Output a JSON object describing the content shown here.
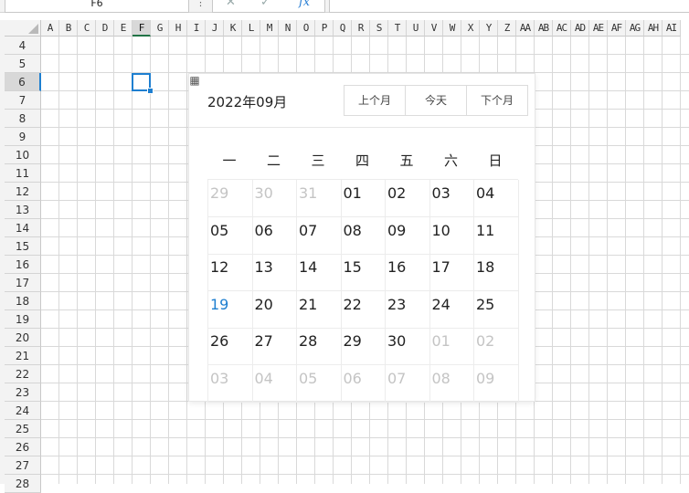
{
  "formula_bar": {
    "name_box": "F6",
    "more_icon": "⋮",
    "cancel_icon": "✕",
    "confirm_icon": "✓",
    "fx_label": "fx",
    "value": ""
  },
  "columns": [
    "A",
    "B",
    "C",
    "D",
    "E",
    "F",
    "G",
    "H",
    "I",
    "J",
    "K",
    "L",
    "M",
    "N",
    "O",
    "P",
    "Q",
    "R",
    "S",
    "T",
    "U",
    "V",
    "W",
    "X",
    "Y",
    "Z",
    "AA",
    "AB",
    "AC",
    "AD",
    "AE",
    "AF",
    "AG",
    "AH",
    "AI"
  ],
  "rows": [
    "4",
    "5",
    "6",
    "7",
    "8",
    "9",
    "10",
    "11",
    "12",
    "13",
    "14",
    "15",
    "16",
    "17",
    "18",
    "19",
    "20",
    "21",
    "22",
    "23",
    "24",
    "25",
    "26",
    "27",
    "28"
  ],
  "selected_column": "F",
  "selected_row": "6",
  "date_picker": {
    "month_label": "2022年09月",
    "prev_label": "上个月",
    "today_label": "今天",
    "next_label": "下个月",
    "weekdays": [
      "一",
      "二",
      "三",
      "四",
      "五",
      "六",
      "日"
    ],
    "weeks": [
      [
        {
          "d": "29",
          "o": true
        },
        {
          "d": "30",
          "o": true
        },
        {
          "d": "31",
          "o": true
        },
        {
          "d": "01"
        },
        {
          "d": "02"
        },
        {
          "d": "03"
        },
        {
          "d": "04"
        }
      ],
      [
        {
          "d": "05"
        },
        {
          "d": "06"
        },
        {
          "d": "07"
        },
        {
          "d": "08"
        },
        {
          "d": "09"
        },
        {
          "d": "10"
        },
        {
          "d": "11"
        }
      ],
      [
        {
          "d": "12"
        },
        {
          "d": "13"
        },
        {
          "d": "14"
        },
        {
          "d": "15"
        },
        {
          "d": "16"
        },
        {
          "d": "17"
        },
        {
          "d": "18"
        }
      ],
      [
        {
          "d": "19",
          "t": true
        },
        {
          "d": "20"
        },
        {
          "d": "21"
        },
        {
          "d": "22"
        },
        {
          "d": "23"
        },
        {
          "d": "24"
        },
        {
          "d": "25"
        }
      ],
      [
        {
          "d": "26"
        },
        {
          "d": "27"
        },
        {
          "d": "28"
        },
        {
          "d": "29"
        },
        {
          "d": "30"
        },
        {
          "d": "01",
          "o": true
        },
        {
          "d": "02",
          "o": true
        }
      ],
      [
        {
          "d": "03",
          "o": true
        },
        {
          "d": "04",
          "o": true
        },
        {
          "d": "05",
          "o": true
        },
        {
          "d": "06",
          "o": true
        },
        {
          "d": "07",
          "o": true
        },
        {
          "d": "08",
          "o": true
        },
        {
          "d": "09",
          "o": true
        }
      ]
    ]
  },
  "colors": {
    "accent": "#1e7fd0",
    "grid": "#d9d9d9",
    "muted": "#c4c4c4"
  }
}
